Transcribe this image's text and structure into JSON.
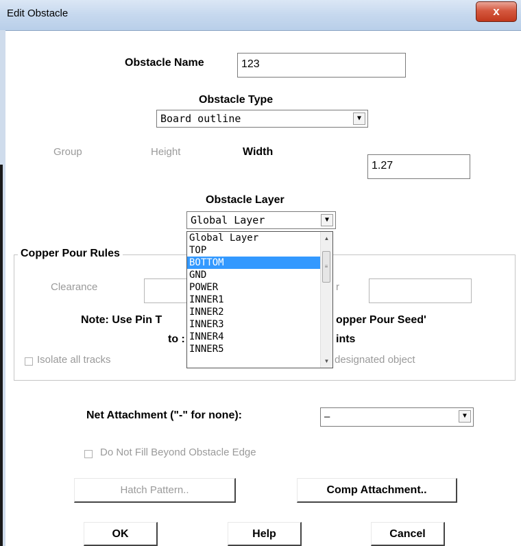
{
  "window": {
    "title": "Edit Obstacle",
    "close_glyph": "x"
  },
  "obstacle_name": {
    "label": "Obstacle Name",
    "value": "123"
  },
  "obstacle_type": {
    "label": "Obstacle Type",
    "selected": "Board outline"
  },
  "size": {
    "group_label": "Group",
    "height_label": "Height",
    "width_label": "Width",
    "width_value": "1.27"
  },
  "obstacle_layer": {
    "label": "Obstacle Layer",
    "selected": "Global Layer",
    "options": [
      "Global Layer",
      "TOP",
      "BOTTOM",
      "GND",
      "POWER",
      "INNER1",
      "INNER2",
      "INNER3",
      "INNER4",
      "INNER5"
    ],
    "highlighted": "BOTTOM"
  },
  "copper_pour": {
    "title": "Copper Pour Rules",
    "clearance_label": "Clearance",
    "right_label_fragment": "r",
    "note_line1_left": "Note: Use Pin T",
    "note_line1_right": "opper Pour Seed'",
    "note_line2_left": "to :",
    "note_line2_right": "ints",
    "isolate_label": "Isolate all tracks",
    "designated_fragment": "designated object"
  },
  "net_attachment": {
    "label": "Net Attachment (\"-\" for none):",
    "selected": "–"
  },
  "do_not_fill_label": "Do Not Fill Beyond Obstacle Edge",
  "buttons": {
    "hatch": "Hatch Pattern..",
    "comp": "Comp Attachment..",
    "ok": "OK",
    "help": "Help",
    "cancel": "Cancel"
  },
  "icons": {
    "dropdown_arrow": "▼",
    "scroll_up": "▲",
    "scroll_down": "▼",
    "thumb_grip": "≡"
  }
}
